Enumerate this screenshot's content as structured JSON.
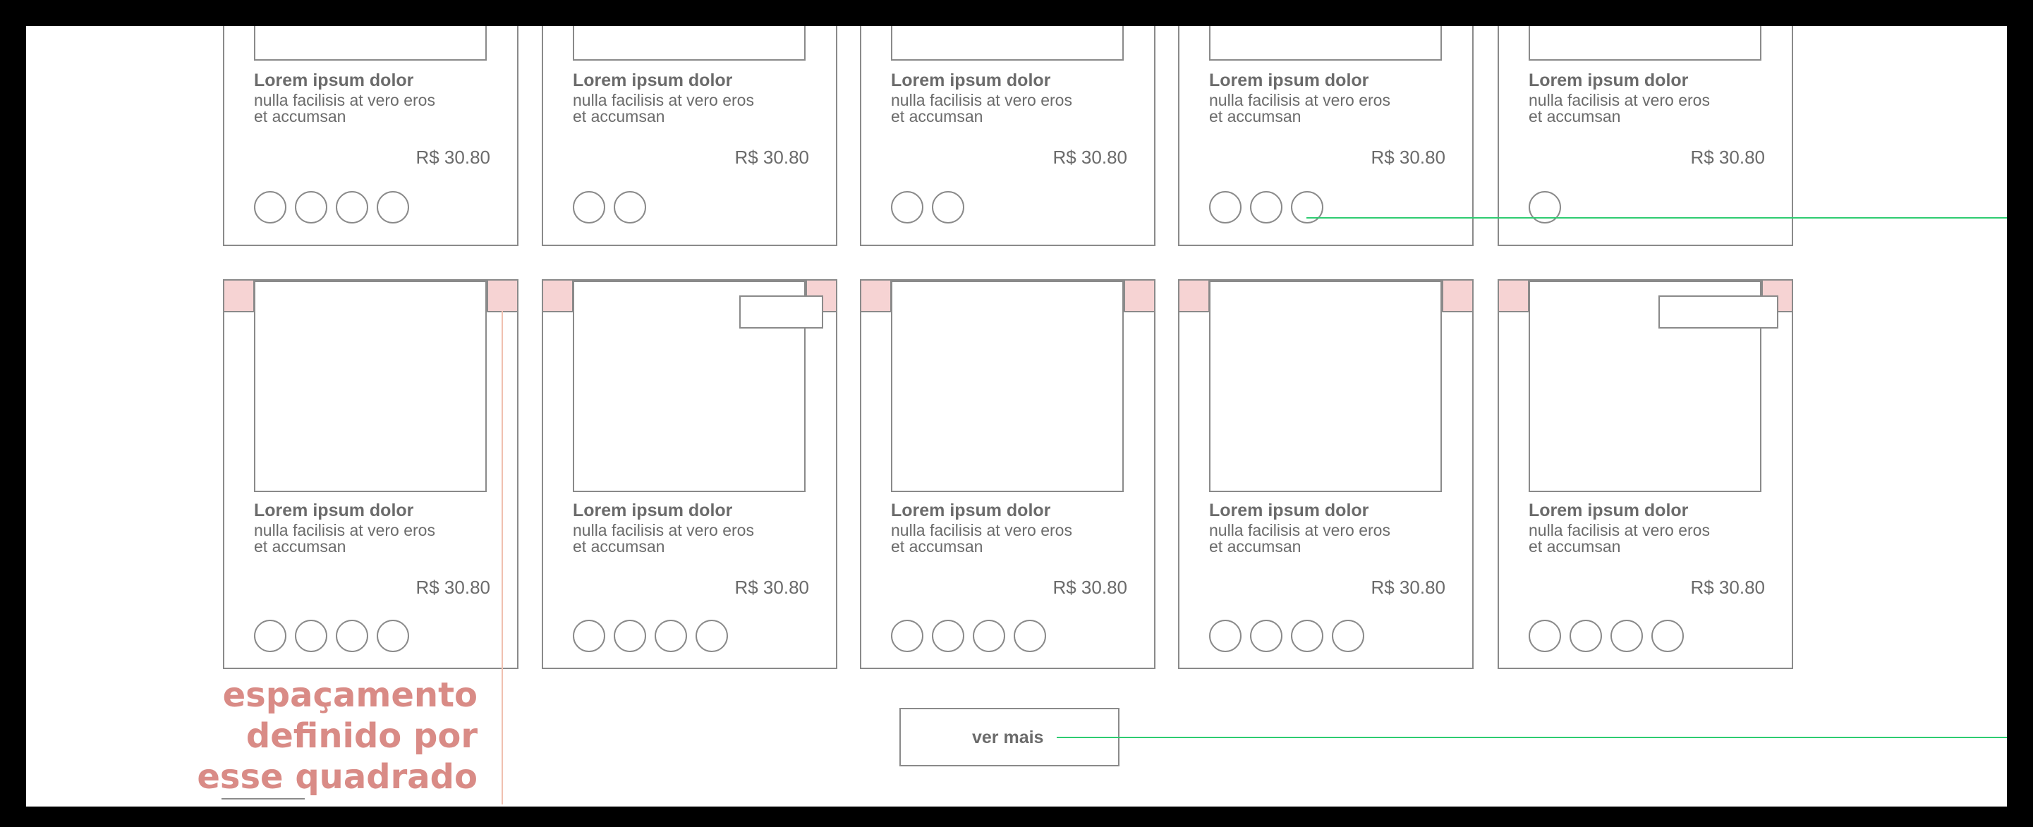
{
  "products_row1": [
    {
      "title": "Lorem ipsum dolor",
      "desc": [
        "nulla facilisis at vero eros",
        "et accumsan"
      ],
      "price": "R$ 30.80",
      "swatch_count": 4
    },
    {
      "title": "Lorem ipsum dolor",
      "desc": [
        "nulla facilisis at vero eros",
        "et accumsan"
      ],
      "price": "R$ 30.80",
      "swatch_count": 2
    },
    {
      "title": "Lorem ipsum dolor",
      "desc": [
        "nulla facilisis at vero eros",
        "et accumsan"
      ],
      "price": "R$ 30.80",
      "swatch_count": 2
    },
    {
      "title": "Lorem ipsum dolor",
      "desc": [
        "nulla facilisis at vero eros",
        "et accumsan"
      ],
      "price": "R$ 30.80",
      "swatch_count": 3
    },
    {
      "title": "Lorem ipsum dolor",
      "desc": [
        "nulla facilisis at vero eros",
        "et accumsan"
      ],
      "price": "R$ 30.80",
      "swatch_count": 1
    }
  ],
  "products_row2": [
    {
      "title": "Lorem ipsum dolor",
      "desc": [
        "nulla facilisis at vero eros",
        "et accumsan"
      ],
      "price": "R$ 30.80",
      "swatch_count": 4,
      "has_tag": false
    },
    {
      "title": "Lorem ipsum dolor",
      "desc": [
        "nulla facilisis at vero eros",
        "et accumsan"
      ],
      "price": "R$ 30.80",
      "swatch_count": 4,
      "has_tag": true
    },
    {
      "title": "Lorem ipsum dolor",
      "desc": [
        "nulla facilisis at vero eros",
        "et accumsan"
      ],
      "price": "R$ 30.80",
      "swatch_count": 4,
      "has_tag": false
    },
    {
      "title": "Lorem ipsum dolor",
      "desc": [
        "nulla facilisis at vero eros",
        "et accumsan"
      ],
      "price": "R$ 30.80",
      "swatch_count": 4,
      "has_tag": false
    },
    {
      "title": "Lorem ipsum dolor",
      "desc": [
        "nulla facilisis at vero eros",
        "et accumsan"
      ],
      "price": "R$ 30.80",
      "swatch_count": 4,
      "has_tag": true
    }
  ],
  "load_more": {
    "label": "ver mais"
  },
  "annotation": {
    "lines": [
      "espaçamento",
      "definido por",
      "esse quadrado"
    ]
  },
  "colors": {
    "frame": "#000000",
    "border": "#8a8a8a",
    "text": "#6b6b6b",
    "padding_marker": "#f6d3d3",
    "annotation": "#d98b86",
    "connector": "#2ecc71"
  }
}
